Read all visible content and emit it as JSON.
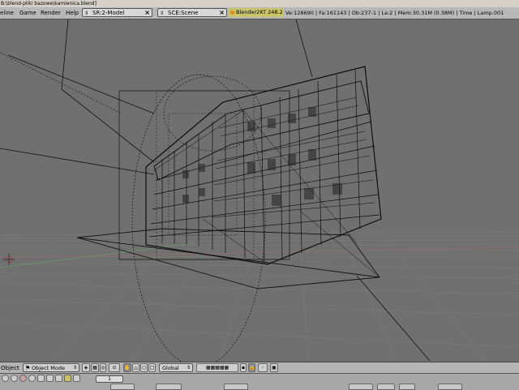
{
  "title_bar": {
    "path": "B:\\blend-pliki bazowe\\kamienica.blend]"
  },
  "menu": [
    {
      "label": "eline"
    },
    {
      "label": "Game"
    },
    {
      "label": "Render"
    },
    {
      "label": "Help"
    }
  ],
  "screen_selector": {
    "value": "SR:2-Model"
  },
  "scene_selector": {
    "value": "SCE:Scene"
  },
  "engine": {
    "label": "Blender2KT 248.2"
  },
  "stats": {
    "text": "Ve:128690 | Fa:161143 | Ob:237-1 | La:2 | Mem:30.31M (0.38M) | Time | Lamp.001"
  },
  "viewport_header": {
    "view_menu": "Object",
    "mode": "Object Mode",
    "orientation": "Global"
  },
  "buttons_window": {
    "frame": "1"
  },
  "icons": [
    "blender-view-icon",
    "mode-icon",
    "draw-type-icon",
    "shading-icon",
    "pivot-icon",
    "manipulator-icon",
    "layer-icon",
    "lock-icon",
    "render-icon",
    "camera-icon",
    "lamp-icon",
    "mesh-icon",
    "material-icon"
  ],
  "colors": {
    "viewport_bg": "#707070",
    "header_bg": "#b8b8b8",
    "engine_badge": "#c9c46a",
    "grid_line": "#7a7a7a",
    "x_axis": "#a06060",
    "y_axis": "#60a060"
  }
}
